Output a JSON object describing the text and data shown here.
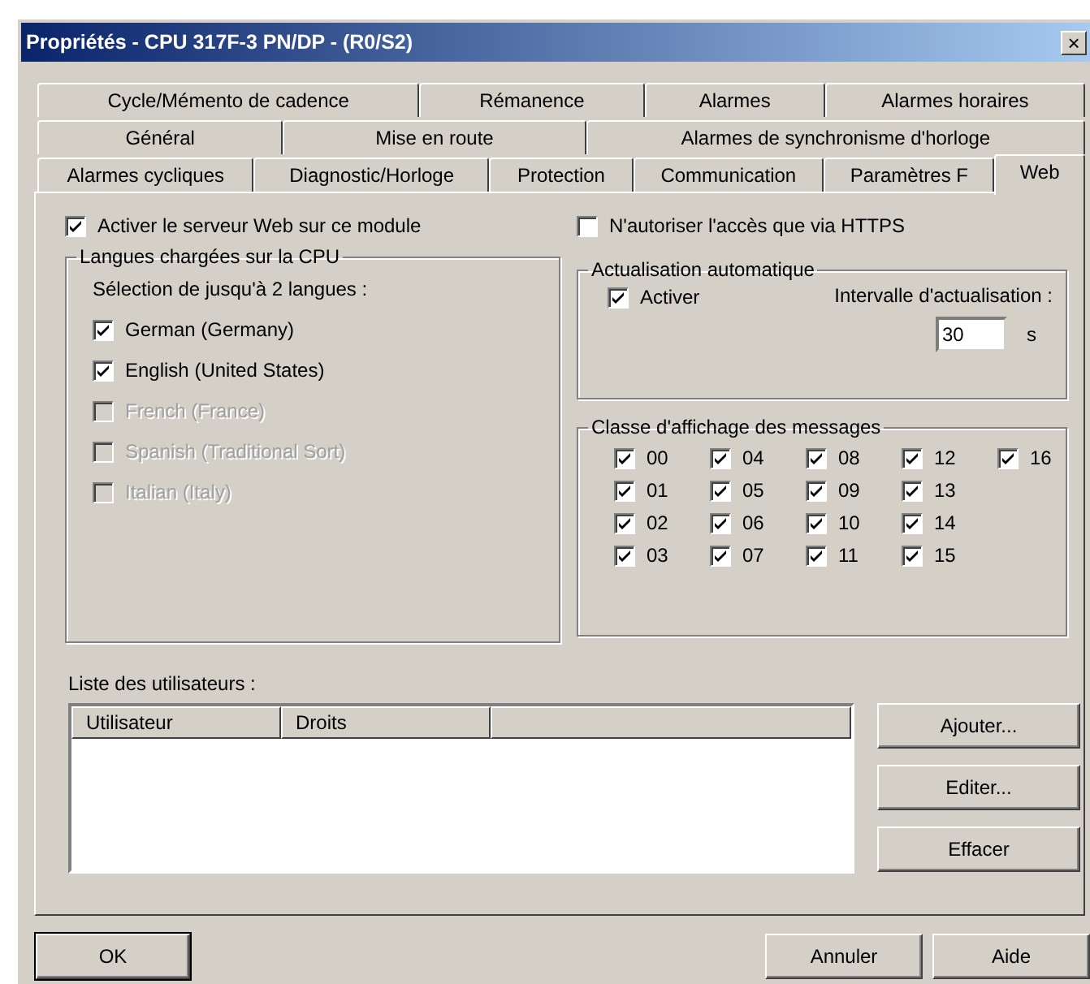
{
  "window": {
    "title": "Propriétés - CPU 317F-3 PN/DP - (R0/S2)",
    "close": "×"
  },
  "tab_rows": [
    [
      {
        "label": "Cycle/Mémento de cadence",
        "selected": false
      },
      {
        "label": "Rémanence",
        "selected": false
      },
      {
        "label": "Alarmes",
        "selected": false
      },
      {
        "label": "Alarmes horaires",
        "selected": false
      }
    ],
    [
      {
        "label": "Général",
        "selected": false
      },
      {
        "label": "Mise en route",
        "selected": false
      },
      {
        "label": "Alarmes de synchronisme d'horloge",
        "selected": false
      }
    ],
    [
      {
        "label": "Alarmes cycliques",
        "selected": false
      },
      {
        "label": "Diagnostic/Horloge",
        "selected": false
      },
      {
        "label": "Protection",
        "selected": false
      },
      {
        "label": "Communication",
        "selected": false
      },
      {
        "label": "Paramètres F",
        "selected": false
      },
      {
        "label": "Web",
        "selected": true
      }
    ]
  ],
  "enable_server": {
    "label": "Activer le serveur Web sur ce module",
    "checked": true
  },
  "https_only": {
    "label": "N'autoriser l'accès que via HTTPS",
    "checked": false
  },
  "languages": {
    "title": "Langues chargées sur la CPU",
    "hint": "Sélection de jusqu'à 2 langues :",
    "items": [
      {
        "label": "German (Germany)",
        "checked": true,
        "disabled": false
      },
      {
        "label": "English (United States)",
        "checked": true,
        "disabled": false
      },
      {
        "label": "French (France)",
        "checked": false,
        "disabled": true
      },
      {
        "label": "Spanish (Traditional Sort)",
        "checked": false,
        "disabled": true
      },
      {
        "label": "Italian (Italy)",
        "checked": false,
        "disabled": true
      }
    ]
  },
  "auto_refresh": {
    "title": "Actualisation automatique",
    "enable": {
      "label": "Activer",
      "checked": true
    },
    "interval_label": "Intervalle d'actualisation :",
    "interval_value": "30",
    "unit": "s"
  },
  "message_classes": {
    "title": "Classe d'affichage des messages",
    "items": [
      {
        "label": "00",
        "checked": true
      },
      {
        "label": "01",
        "checked": true
      },
      {
        "label": "02",
        "checked": true
      },
      {
        "label": "03",
        "checked": true
      },
      {
        "label": "04",
        "checked": true
      },
      {
        "label": "05",
        "checked": true
      },
      {
        "label": "06",
        "checked": true
      },
      {
        "label": "07",
        "checked": true
      },
      {
        "label": "08",
        "checked": true
      },
      {
        "label": "09",
        "checked": true
      },
      {
        "label": "10",
        "checked": true
      },
      {
        "label": "11",
        "checked": true
      },
      {
        "label": "12",
        "checked": true
      },
      {
        "label": "13",
        "checked": true
      },
      {
        "label": "14",
        "checked": true
      },
      {
        "label": "15",
        "checked": true
      },
      {
        "label": "16",
        "checked": true
      }
    ]
  },
  "users": {
    "label": "Liste des utilisateurs :",
    "columns": [
      "Utilisateur",
      "Droits"
    ],
    "buttons": [
      "Ajouter...",
      "Editer...",
      "Effacer"
    ]
  },
  "buttons": [
    {
      "label": "OK",
      "default": true
    },
    {
      "label": "Annuler",
      "default": false
    },
    {
      "label": "Aide",
      "default": false
    }
  ]
}
